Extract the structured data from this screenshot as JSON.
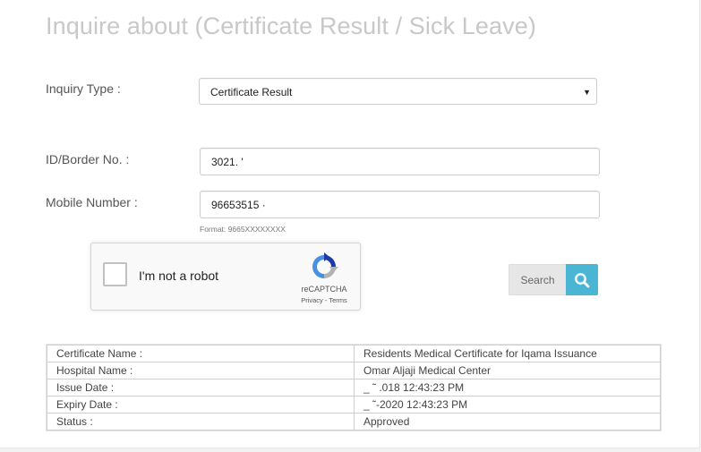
{
  "page": {
    "title": "Inquire about (Certificate Result / Sick Leave)"
  },
  "form": {
    "inquiry_type_label": "Inquiry Type :",
    "inquiry_type_value": "Certificate Result",
    "id_label": "ID/Border No. :",
    "id_value": "3021.  '",
    "mobile_label": "Mobile Number :",
    "mobile_value": "96653515    ·",
    "mobile_hint": "Format: 9665XXXXXXXX"
  },
  "captcha": {
    "checkbox_label": "I'm not a robot",
    "brand": "reCAPTCHA",
    "links": "Privacy - Terms"
  },
  "search_button": {
    "label": "Search",
    "icon": "magnifier-icon",
    "accent": "#4ab6d4"
  },
  "results": [
    {
      "key": "Certificate Name :",
      "value": "Residents Medical Certificate for Iqama Issuance"
    },
    {
      "key": "Hospital Name :",
      "value": "Omar Aljaji Medical Center"
    },
    {
      "key": "Issue Date :",
      "value": "_  ˜  .018 12:43:23 PM"
    },
    {
      "key": "Expiry Date :",
      "value": "_   ˜-2020 12:43:23 PM"
    },
    {
      "key": "Status :",
      "value": "Approved"
    }
  ]
}
